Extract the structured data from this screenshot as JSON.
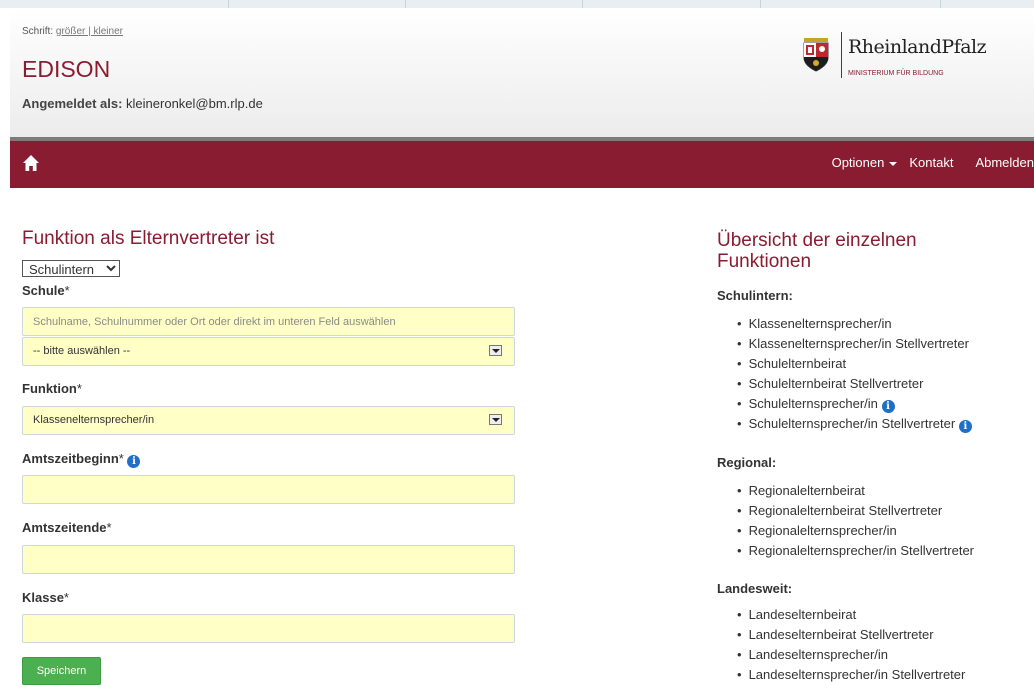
{
  "header": {
    "font_label": "Schrift:",
    "font_larger": "größer",
    "font_sep": " | ",
    "font_smaller": "kleiner",
    "app_title": "EDISON",
    "login_label": "Angemeldet als:",
    "login_user": "kleineronkel@bm.rlp.de",
    "logo_name": "RheinlandPfalz",
    "logo_sub": "MINISTERIUM FÜR BILDUNG"
  },
  "nav": {
    "options": "Optionen",
    "contact": "Kontakt",
    "logout": "Abmelden"
  },
  "form": {
    "title": "Funktion als Elternvertreter ist",
    "scope_value": "Schulintern",
    "school_label": "Schule",
    "school_placeholder": "Schulname, Schulnummer oder Ort oder direkt im unteren Feld auswählen",
    "school_select": "-- bitte auswählen --",
    "function_label": "Funktion",
    "function_value": "Klassenelternsprecher/in",
    "term_start_label": "Amtszeitbeginn",
    "term_end_label": "Amtszeitende",
    "class_label": "Klasse",
    "required_mark": "*",
    "save": "Speichern"
  },
  "overview": {
    "title": "Übersicht der einzelnen Funktionen",
    "sections": [
      {
        "title": "Schulintern:",
        "items": [
          "Klassenelternsprecher/in",
          "Klassenelternsprecher/in Stellvertreter",
          "Schulelternbeirat",
          "Schulelternbeirat Stellvertreter",
          "Schulelternsprecher/in",
          "Schulelternsprecher/in Stellvertreter"
        ]
      },
      {
        "title": "Regional:",
        "items": [
          "Regionalelternbeirat",
          "Regionalelternbeirat Stellvertreter",
          "Regionalelternsprecher/in",
          "Regionalelternsprecher/in Stellvertreter"
        ]
      },
      {
        "title": "Landesweit:",
        "items": [
          "Landeselternbeirat",
          "Landeselternbeirat Stellvertreter",
          "Landeselternsprecher/in",
          "Landeselternsprecher/in Stellvertreter"
        ]
      }
    ]
  },
  "icons": {
    "info": "i"
  },
  "colors": {
    "brand": "#8a1c31",
    "field_bg": "#ffffc6",
    "save": "#4caf50",
    "info": "#1f6fc9"
  }
}
